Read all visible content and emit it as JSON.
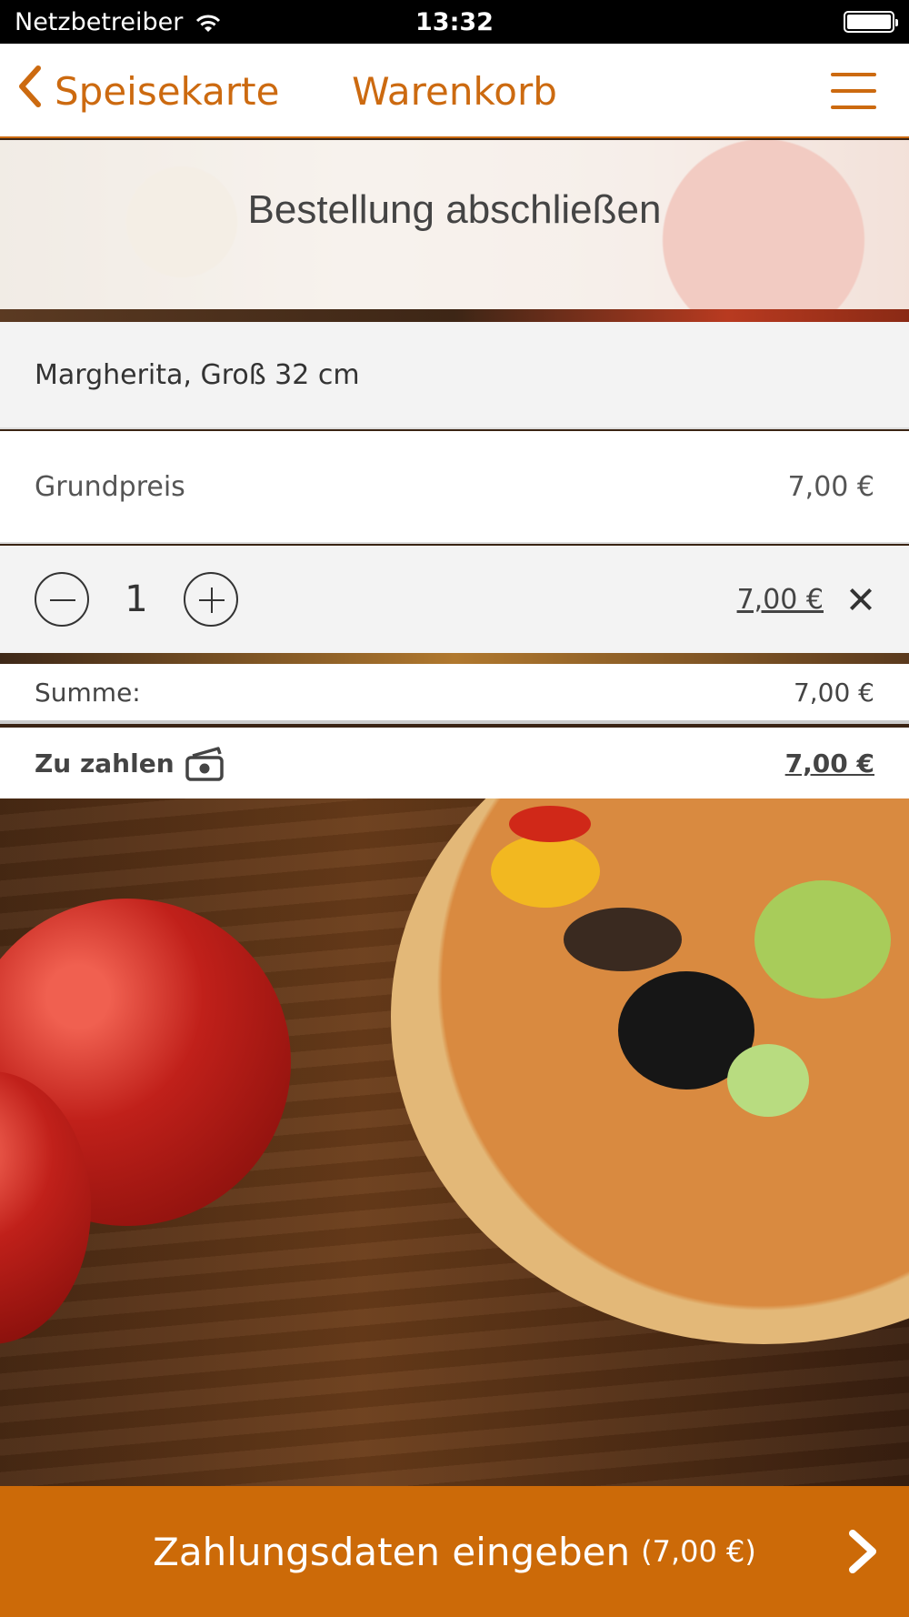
{
  "status_bar": {
    "carrier": "Netzbetreiber",
    "time": "13:32"
  },
  "nav": {
    "back_label": "Speisekarte",
    "title": "Warenkorb"
  },
  "banner": {
    "title": "Bestellung abschließen"
  },
  "cart": {
    "item_name": "Margherita, Groß 32 cm",
    "base_price_label": "Grundpreis",
    "base_price_value": "7,00 €",
    "quantity": "1",
    "line_total": "7,00 €"
  },
  "summary": {
    "sum_label": "Summe:",
    "sum_value": "7,00 €",
    "pay_label": "Zu zahlen",
    "pay_value": "7,00 €"
  },
  "cta": {
    "label": "Zahlungsdaten eingeben",
    "amount": "(7,00 €)"
  },
  "colors": {
    "accent": "#cc6a08",
    "row_bg": "#f3f3f3"
  }
}
